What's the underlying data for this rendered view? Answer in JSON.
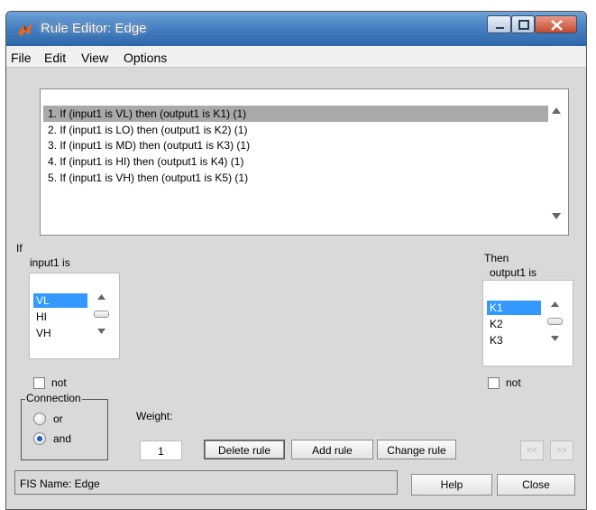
{
  "window": {
    "title": "Rule Editor: Edge"
  },
  "menu": [
    "File",
    "Edit",
    "View",
    "Options"
  ],
  "rules": [
    "1. If (input1 is VL) then (output1 is K1) (1)",
    "2. If (input1 is LO) then (output1 is K2) (1)",
    "3. If (input1 is MD) then (output1 is K3) (1)",
    "4. If (input1 is HI) then (output1 is K4) (1)",
    "5. If (input1 is VH) then (output1 is K5) (1)"
  ],
  "selected_rule_index": 0,
  "if_panel": {
    "header": "If",
    "variable_label": "input1 is",
    "options": [
      "VL",
      "HI",
      "VH"
    ],
    "selected": "VL",
    "not_label": "not",
    "not_checked": false
  },
  "then_panel": {
    "header": "Then",
    "variable_label": "output1 is",
    "options": [
      "K1",
      "K2",
      "K3"
    ],
    "selected": "K1",
    "not_label": "not",
    "not_checked": false
  },
  "connection": {
    "title": "Connection",
    "or_label": "or",
    "and_label": "and",
    "selected": "and"
  },
  "weight": {
    "label": "Weight:",
    "value": "1"
  },
  "buttons": {
    "delete_rule": "Delete rule",
    "add_rule": "Add rule",
    "change_rule": "Change rule",
    "prev": "<<",
    "next": ">>",
    "help": "Help",
    "close": "Close"
  },
  "status": "FIS Name: Edge",
  "colors": {
    "titlebar": "#2d66aa",
    "selection": "#3399ff",
    "window_bg": "#d9d9d9"
  }
}
